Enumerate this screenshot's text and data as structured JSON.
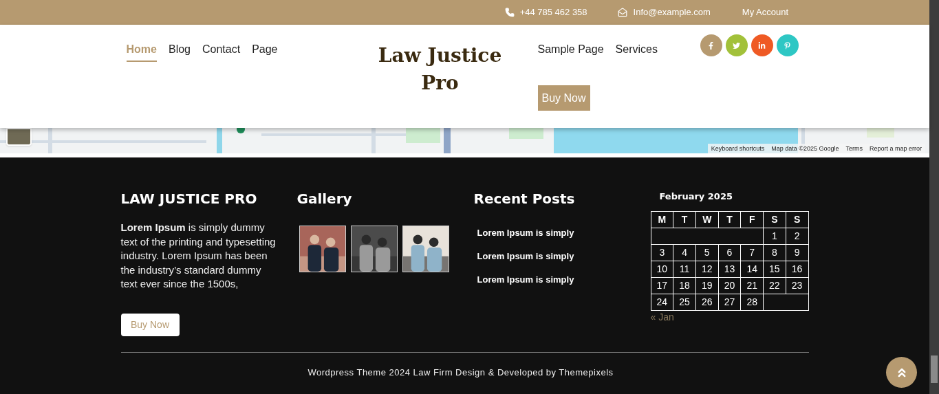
{
  "topbar": {
    "phone": "+44 785 462 358",
    "email": "Info@example.com",
    "account": "My Account"
  },
  "header": {
    "logo": "Law Justice Pro",
    "nav_left": [
      {
        "label": "Home",
        "selected": true
      },
      {
        "label": "Blog",
        "selected": false
      },
      {
        "label": "Contact",
        "selected": false
      },
      {
        "label": "Page",
        "selected": false
      }
    ],
    "nav_right": [
      {
        "label": "Sample Page",
        "selected": false
      },
      {
        "label": "Services",
        "selected": false
      }
    ],
    "button": "Buy Now",
    "social": [
      {
        "kind": "facebook",
        "color": "#b69a70"
      },
      {
        "kind": "twitter",
        "color": "#a2c13a"
      },
      {
        "kind": "linkedin",
        "color": "#ef5a24"
      },
      {
        "kind": "pinterest",
        "color": "#2ec7c4"
      }
    ]
  },
  "map": {
    "attribution": [
      "Keyboard shortcuts",
      "Map data ©2025 Google",
      "Terms",
      "Report a map error"
    ]
  },
  "footer": {
    "about": {
      "title": "LAW JUSTICE PRO",
      "text": "**Lorem Ipsum** is simply dummy text of the printing and typesetting industry. Lorem Ipsum has been the industry’s standard dummy text ever since the 1500s,",
      "button": "Buy Now"
    },
    "gallery": {
      "title": "Gallery"
    },
    "recent_posts": {
      "title": "Recent Posts",
      "posts": [
        "Lorem Ipsum is simply",
        "Lorem Ipsum is simply",
        "Lorem Ipsum is simply"
      ]
    },
    "calendar": {
      "title": "February 2025",
      "weekdays": [
        "M",
        "T",
        "W",
        "T",
        "F",
        "S",
        "S"
      ],
      "weeks": [
        [
          "1",
          "2"
        ],
        [
          "3",
          "4",
          "5",
          "6",
          "7",
          "8",
          "9"
        ],
        [
          "10",
          "11",
          "12",
          "13",
          "14",
          "15",
          "16"
        ],
        [
          "17",
          "18",
          "19",
          "20",
          "21",
          "22",
          "23"
        ],
        [
          "24",
          "25",
          "26",
          "27",
          "28"
        ]
      ],
      "prev": "« Jan"
    },
    "copyright": "Wordpress Theme 2024 Law Firm Design & Developed by Themepixels"
  }
}
